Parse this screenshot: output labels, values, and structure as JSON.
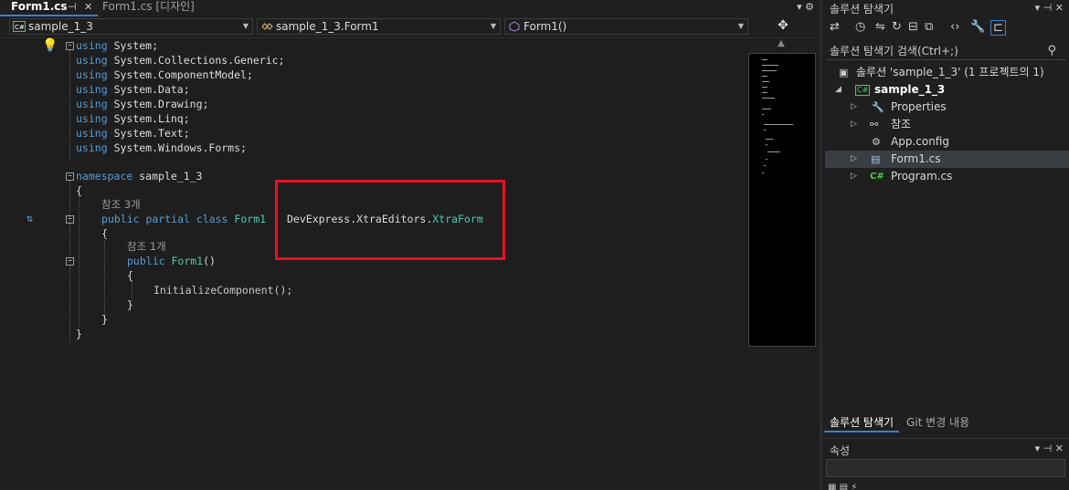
{
  "editor": {
    "tabs": [
      {
        "label": "Form1.cs",
        "active": true
      },
      {
        "label": "Form1.cs [디자인]",
        "active": false
      }
    ],
    "tab_pin_glyph": "⊣",
    "tab_close_glyph": "✕",
    "tabstrip_right": "▾ ⚙",
    "nav": {
      "project": "sample_1_3",
      "type": "sample_1_3.Form1",
      "member": "Form1()",
      "split_glyph": "✥"
    },
    "code": {
      "usings": [
        "System;",
        "System.Collections.Generic;",
        "System.ComponentModel;",
        "System.Data;",
        "System.Drawing;",
        "System.Linq;",
        "System.Text;",
        "System.Windows.Forms;"
      ],
      "using_kw": "using",
      "namespace_kw": "namespace",
      "namespace_name": "sample_1_3",
      "open_brace": "{",
      "close_brace": "}",
      "class_refs": "참조 3개",
      "class_decl_kw": "public partial class",
      "class_name": "Form1",
      "base_prefix": "DevExpress.XtraEditors.",
      "base_type": "XtraForm",
      "ctor_refs": "참조 1개",
      "ctor_kw": "public",
      "ctor_name": "Form1",
      "ctor_parens": "()",
      "ctor_body": "InitializeComponent();"
    },
    "highlight_color": "#e81123"
  },
  "solution_explorer": {
    "title": "솔루션 탐색기",
    "title_controls": "▾ ⊣ ✕",
    "search_placeholder": "솔루션 탐색기 검색(Ctrl+;)",
    "tree": [
      {
        "label": "솔루션 'sample_1_3' (1 프로젝트의 1)",
        "icon": "solution-icon"
      },
      {
        "label": "sample_1_3",
        "icon": "csharp-project-icon",
        "bold": true
      },
      {
        "label": "Properties",
        "icon": "wrench-icon"
      },
      {
        "label": "참조",
        "icon": "references-icon"
      },
      {
        "label": "App.config",
        "icon": "config-icon"
      },
      {
        "label": "Form1.cs",
        "icon": "form-icon",
        "selected": true
      },
      {
        "label": "Program.cs",
        "icon": "csharp-file-icon"
      }
    ],
    "bottom_tabs": [
      {
        "label": "솔루션 탐색기",
        "active": true
      },
      {
        "label": "Git 변경 내용",
        "active": false
      }
    ]
  },
  "properties": {
    "title": "속성",
    "title_controls": "▾ ⊣ ✕"
  },
  "colors": {
    "accent": "#3c7fd6",
    "keyword": "#569cd6",
    "type": "#4ec9b0"
  }
}
